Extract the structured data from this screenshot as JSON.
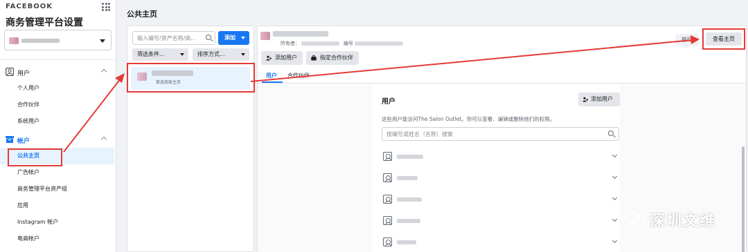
{
  "sidebar": {
    "brand": "FACEBOOK",
    "app_title": "商务管理平台设置",
    "sections": [
      {
        "label": "用户",
        "items": [
          "个人用户",
          "合作伙伴",
          "系统用户"
        ]
      },
      {
        "label": "帐户",
        "items": [
          "公共主页",
          "广告帐户",
          "商务管理平台资产组",
          "应用",
          "Instagram 帐户",
          "电商帐户"
        ]
      }
    ]
  },
  "header": {
    "title": "公共主页"
  },
  "list_panel": {
    "search_placeholder": "输入编号/资产名称/商...",
    "add_label": "添加",
    "filter_label": "筛选条件...",
    "sort_label": "排序方式...",
    "item_subtitle": "首选商家主页"
  },
  "detail": {
    "owner_label": "所有者：",
    "id_label": "编号",
    "actions": [
      "添加用户",
      "指定合作伙伴"
    ],
    "remove_label": "移除",
    "view_label": "查看主页",
    "tabs": [
      "用户",
      "合作伙伴"
    ],
    "users": {
      "title": "用户",
      "add_user_label": "添加用户",
      "description": "这些用户能访问The Salon Outlet。你可以查看、编辑或删除他们的权限。",
      "search_placeholder": "按编号或姓名（名称）搜索"
    }
  },
  "watermark": "深圳文维",
  "colors": {
    "accent": "#1877f2",
    "annotation": "#e53935"
  }
}
